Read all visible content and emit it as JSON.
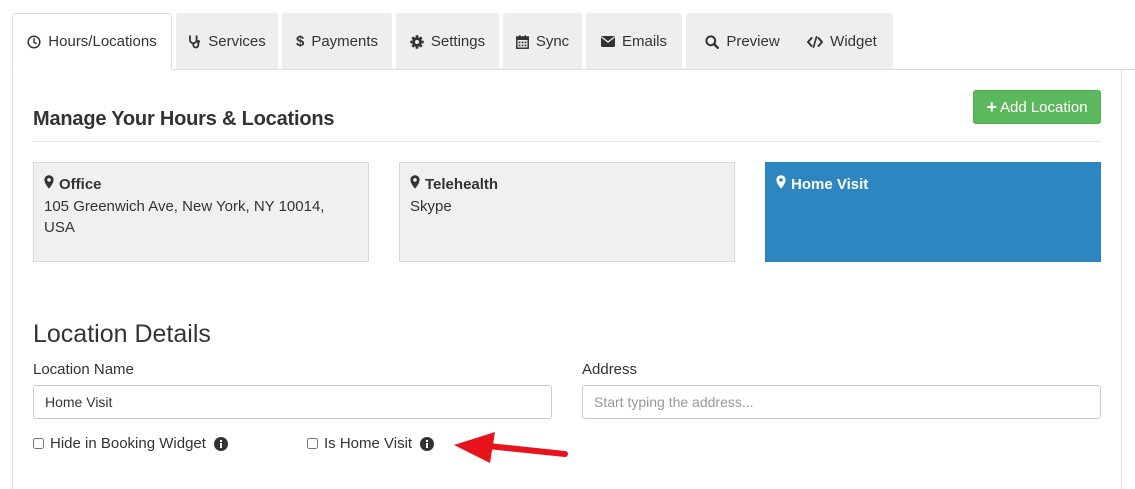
{
  "tabs": [
    {
      "label": "Hours/Locations",
      "icon": "clock-icon",
      "active": true
    },
    {
      "label": "Services",
      "icon": "stethoscope-icon"
    },
    {
      "label": "Payments",
      "icon": "dollar-icon"
    },
    {
      "label": "Settings",
      "icon": "gear-icon"
    },
    {
      "label": "Sync",
      "icon": "calendar-icon"
    },
    {
      "label": "Emails",
      "icon": "envelope-icon"
    },
    {
      "label": "Preview",
      "icon": "search-icon"
    },
    {
      "label": "Widget",
      "icon": "code-icon"
    }
  ],
  "header": {
    "title": "Manage Your Hours & Locations",
    "add_button_label": "Add Location"
  },
  "locations": [
    {
      "name": "Office",
      "address": "105 Greenwich Ave, New York, NY 10014, USA",
      "icon": "map-marker-icon"
    },
    {
      "name": "Telehealth",
      "address": "Skype",
      "icon": "map-marker-icon"
    },
    {
      "name": "Home Visit",
      "address": "",
      "icon": "map-marker-icon",
      "selected": true
    }
  ],
  "details": {
    "title": "Location Details",
    "name_label": "Location Name",
    "name_value": "Home Visit",
    "address_label": "Address",
    "address_placeholder": "Start typing the address...",
    "hide_widget_label": "Hide in Booking Widget",
    "hide_widget_checked": false,
    "home_visit_label": "Is Home Visit",
    "home_visit_checked": false
  },
  "colors": {
    "accent_blue": "#2e86c1",
    "add_green": "#5cb85c",
    "arrow_red": "#e8141b"
  }
}
